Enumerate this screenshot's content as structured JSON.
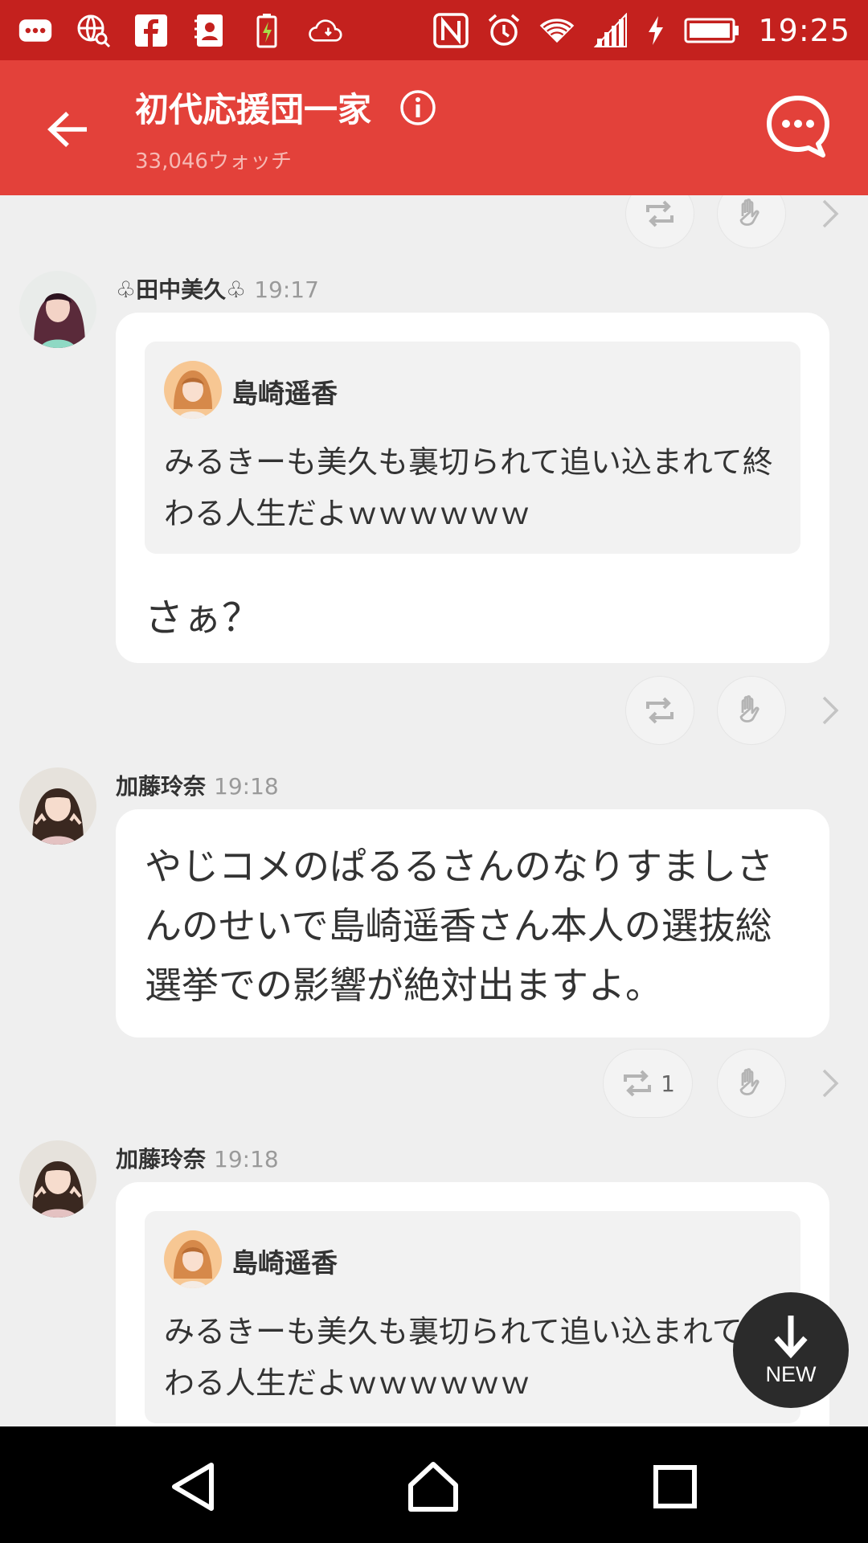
{
  "status_bar": {
    "time": "19:25",
    "left_icons": [
      "chat-notification-icon",
      "browser-icon",
      "facebook-icon",
      "contacts-icon",
      "battery-saver-icon",
      "cloud-icon"
    ],
    "right_icons": [
      "nfc-icon",
      "alarm-icon",
      "wifi-icon",
      "signal-icon",
      "charging-icon",
      "battery-icon"
    ]
  },
  "header": {
    "title": "初代応援団一家",
    "watch_count": "33,046ウォッチ"
  },
  "messages": [
    {
      "sender": "♧田中美久♧",
      "time": "19:17",
      "quote": {
        "name": "島崎遥香",
        "text": "みるきーも美久も裏切られて追い込まれて終わる人生だよｗｗｗｗｗｗ"
      },
      "text": "さぁ？"
    },
    {
      "sender": "加藤玲奈",
      "time": "19:18",
      "text": "やじコメのぱるるさんのなりすましさんのせいで島崎遥香さん本人の選抜総選挙での影響が絶対出ますよ。",
      "repost_count": "1"
    },
    {
      "sender": "加藤玲奈",
      "time": "19:18",
      "quote": {
        "name": "島崎遥香",
        "text": "みるきーも美久も裏切られて追い込まれて終わる人生だよｗｗｗｗｗｗ"
      }
    }
  ],
  "fab": {
    "label": "NEW"
  },
  "colors": {
    "status_bar": "#c4211e",
    "app_bar": "#e3413a",
    "background": "#efefef",
    "fab": "#2b2b2b"
  }
}
